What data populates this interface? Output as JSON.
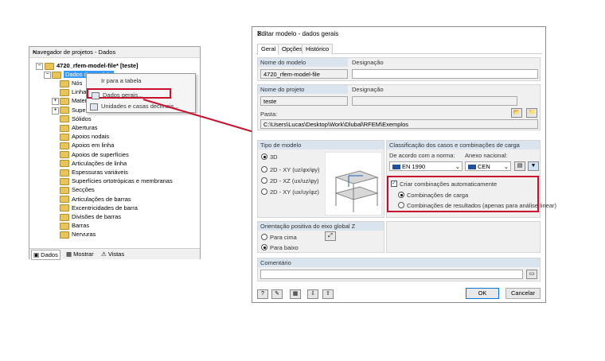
{
  "navigator": {
    "title": "Navegador de projetos - Dados",
    "close": "×",
    "root": "4720_rfem-model-file* [teste]",
    "selected": "Dados do modelo",
    "items": [
      "Nós",
      "Linhas",
      "Materiais",
      "Superfícies",
      "Sólidos",
      "Aberturas",
      "Apoios nodais",
      "Apoios em linha",
      "Apoios de superfícies",
      "Articulações de linha",
      "Espessuras variáveis",
      "Superfícies ortotrópicas e membranas",
      "Secções",
      "Articulações de barras",
      "Excentricidades de barra",
      "Divisões de barras",
      "Barras",
      "Nervuras"
    ],
    "tabs": [
      "Dados",
      "Mostrar",
      "Vistas"
    ]
  },
  "context_menu": {
    "items": [
      "Ir para a tabela",
      "Dados gerais...",
      "Unidades e casas decimais..."
    ]
  },
  "dialog": {
    "title": "Editar modelo - dados gerais",
    "close": "✕",
    "tabs": [
      "Geral",
      "Opções",
      "Histórico"
    ],
    "model_name_label": "Nome do modelo",
    "model_name": "4720_rfem-model-file",
    "designation_label": "Designação",
    "designation_value": "",
    "project_name_label": "Nome do projeto",
    "project_name": "teste",
    "project_designation_label": "Designação",
    "folder_label": "Pasta:",
    "folder": "C:\\Users\\Lucas\\Desktop\\Work\\Dlubal\\RFEM\\Exemplos",
    "model_type_label": "Tipo de modelo",
    "model_types": [
      "3D",
      "2D - XY (uz/φx/φy)",
      "2D - XZ (ux/uz/φy)",
      "2D - XY (ux/uy/φz)"
    ],
    "classification_label": "Classificação dos casos e combinações de carga",
    "standard_label": "De acordo com a norma:",
    "standard_value": "EN 1990",
    "annex_label": "Anexo nacional:",
    "annex_value": "CEN",
    "auto_combos_label": "Criar combinações automaticamente",
    "combo_options": [
      "Combinações de carga",
      "Combinações de resultados (apenas para análise linear)"
    ],
    "z_orient_label": "Orientação positiva do eixo global Z",
    "z_options": [
      "Para cima",
      "Para baixo"
    ],
    "comment_label": "Comentário",
    "comment_value": "",
    "ok": "OK",
    "cancel": "Cancelar"
  },
  "colors": {
    "highlight": "#c8102e",
    "selection": "#3399ff",
    "group_header": "#d9e4ef"
  }
}
